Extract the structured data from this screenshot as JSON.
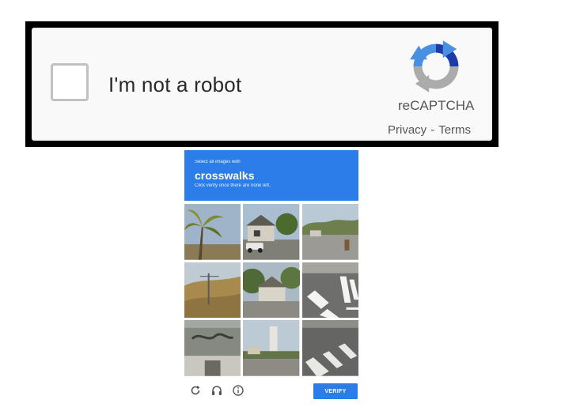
{
  "widget": {
    "label": "I'm not a robot",
    "brand": "reCAPTCHA",
    "privacy": "Privacy",
    "separator": "-",
    "terms": "Terms"
  },
  "challenge": {
    "instruction": "Select all images with",
    "target": "crosswalks",
    "sub": "Click verify once there are none left.",
    "tiles": [
      "palm-tree",
      "house-with-car",
      "street-corner",
      "dry-hillside",
      "house-with-trees",
      "crosswalk-stripes",
      "building-sign",
      "street-with-tower",
      "crosswalk-road"
    ],
    "verify_label": "VERIFY",
    "footer_icons": [
      "reload-icon",
      "audio-icon",
      "info-icon"
    ]
  },
  "colors": {
    "accent": "#2b7de9",
    "widget_bg": "#f9f9f9",
    "frame": "#000000"
  }
}
